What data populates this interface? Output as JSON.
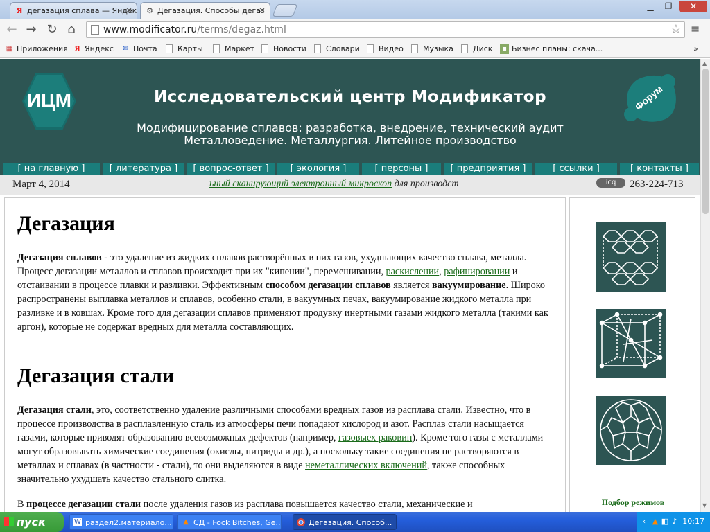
{
  "browser": {
    "tabs": [
      {
        "title": "дегазация сплава — Яндекс",
        "icon": "yandex-icon",
        "active": false
      },
      {
        "title": "Дегазация. Способы дегаз",
        "icon": "site-icon",
        "active": true
      }
    ],
    "url_domain": "www.modificator.ru",
    "url_path": "/terms/degaz.html",
    "bookmarks": [
      {
        "label": "Приложения",
        "icon": "apps-grid-icon"
      },
      {
        "label": "Яндекс",
        "icon": "yandex-icon"
      },
      {
        "label": "Почта",
        "icon": "mail-icon"
      },
      {
        "label": "Карты",
        "icon": "page-icon"
      },
      {
        "label": "Маркет",
        "icon": "page-icon"
      },
      {
        "label": "Новости",
        "icon": "page-icon"
      },
      {
        "label": "Словари",
        "icon": "page-icon"
      },
      {
        "label": "Видео",
        "icon": "page-icon"
      },
      {
        "label": "Музыка",
        "icon": "page-icon"
      },
      {
        "label": "Диск",
        "icon": "page-icon"
      },
      {
        "label": "Бизнес планы: скача...",
        "icon": "image-icon"
      }
    ],
    "bookmarks_more": "»"
  },
  "site": {
    "logo_text": "ИЦМ",
    "title": "Исследовательский центр Модификатор",
    "subtitle1": "Модифицирование сплавов: разработка, внедрение, технический аудит",
    "subtitle2": "Металловедение. Металлургия. Литейное производство",
    "forum_label": "Форум",
    "nav": [
      "[ на главную ]",
      "[ литература ]",
      "[ вопрос-ответ ]",
      "[ экология ]",
      "[ персоны ]",
      "[ предприятия ]",
      "[ ссылки ]",
      "[ контакты ]"
    ],
    "date": "Март 4, 2014",
    "ticker_link": "ьный сканирующий электронный микроскоп",
    "ticker_tail": " для производст",
    "icq_label": "icq",
    "icq_number": "263-224-713"
  },
  "article": {
    "h1": "Дегазация",
    "p1": [
      {
        "t": "Дегазация сплавов",
        "b": true
      },
      {
        "t": " - это удаление из жидких сплавов растворённых в них газов, ухудшающих качество сплава, металла. Процесс дегазации металлов и сплавов происходит при их \"кипении\", перемешивании, "
      },
      {
        "t": "раскислении",
        "link": true
      },
      {
        "t": ", "
      },
      {
        "t": "рафинировании",
        "link": true
      },
      {
        "t": " и отстаивании в процессе плавки и разливки. Эффективным "
      },
      {
        "t": "способом дегазации сплавов",
        "b": true
      },
      {
        "t": " является "
      },
      {
        "t": "вакуумирование",
        "b": true
      },
      {
        "t": ". Широко распространены выплавка металлов и сплавов, особенно стали, в вакуумных печах, вакуумирование жидкого металла при разливке и в ковшах. Кроме того для дегазации сплавов применяют продувку инертными газами жидкого металла (такими как аргон), которые не содержат вредных для металла составляющих."
      }
    ],
    "h2": "Дегазация стали",
    "p2": [
      {
        "t": "Дегазация стали",
        "b": true
      },
      {
        "t": ", это, соответственно удаление различными способами вредных газов из расплава стали. Известно, что в процессе производства в расплавленную сталь из атмосферы печи попадают кислород и азот. Расплав стали насыщается газами, которые приводят образованию всевозможных дефектов (например, "
      },
      {
        "t": "газовыех раковин",
        "link": true
      },
      {
        "t": "). Кроме того газы с металлами могут образовывать химические соединения (окислы, нитриды и др.), а поскольку такие соединения не растворяются в металлах и сплавах (в частности - стали), то они выделяются в виде "
      },
      {
        "t": "неметаллических включений",
        "link": true
      },
      {
        "t": ", также способных значительно ухудшать качество стального слитка."
      }
    ],
    "p3": [
      {
        "t": "В "
      },
      {
        "t": "процессе дегазации стали",
        "b": true
      },
      {
        "t": " после удаления газов из расплава повышается качество стали, механические и"
      }
    ]
  },
  "sidebar": {
    "images": [
      "graphite-lattice-image",
      "cubic-crystal-lattice-image",
      "fullerene-molecule-image"
    ],
    "caption": "Подбор режимов"
  },
  "taskbar": {
    "start": "пуск",
    "tasks": [
      {
        "title": "раздел2.материало...",
        "icon": "word-icon",
        "active": false
      },
      {
        "title": "СД - Fock Bitches, Ge...",
        "icon": "vlc-icon",
        "active": false
      },
      {
        "title": "Дегазация. Способ...",
        "icon": "chrome-icon",
        "active": true
      }
    ],
    "clock": "10:17"
  }
}
